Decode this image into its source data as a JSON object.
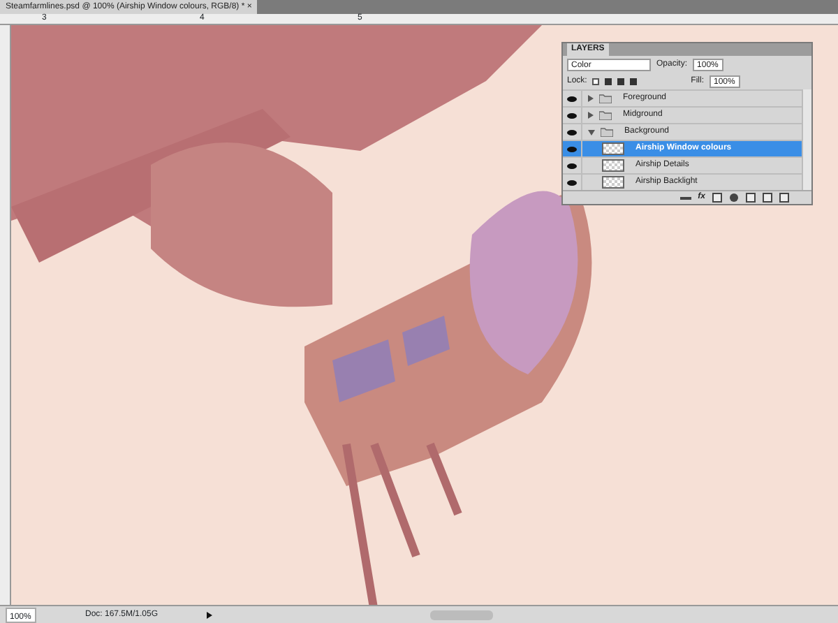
{
  "document_tab": {
    "title": "Steamfarmlines.psd @ 100% (Airship Window colours, RGB/8) *",
    "close": "×"
  },
  "ruler": {
    "labels": [
      "3",
      "4",
      "5"
    ]
  },
  "layers_panel": {
    "title": "LAYERS",
    "blend_mode": "Color",
    "opacity_label": "Opacity:",
    "opacity": "100%",
    "lock_label": "Lock:",
    "fill_label": "Fill:",
    "fill": "100%",
    "fx": "fx",
    "layers": [
      {
        "name": "Foreground",
        "kind": "group",
        "expanded": false,
        "selected": false
      },
      {
        "name": "Midground",
        "kind": "group",
        "expanded": false,
        "selected": false
      },
      {
        "name": "Background",
        "kind": "group",
        "expanded": true,
        "selected": false,
        "children": [
          {
            "name": "Airship Window colours",
            "kind": "layer",
            "selected": true
          },
          {
            "name": "Airship Details",
            "kind": "layer",
            "selected": false
          },
          {
            "name": "Airship Backlight",
            "kind": "layer",
            "selected": false
          }
        ]
      }
    ]
  },
  "status_bar": {
    "zoom": "100%",
    "doc_info": "Doc: 167.5M/1.05G"
  }
}
